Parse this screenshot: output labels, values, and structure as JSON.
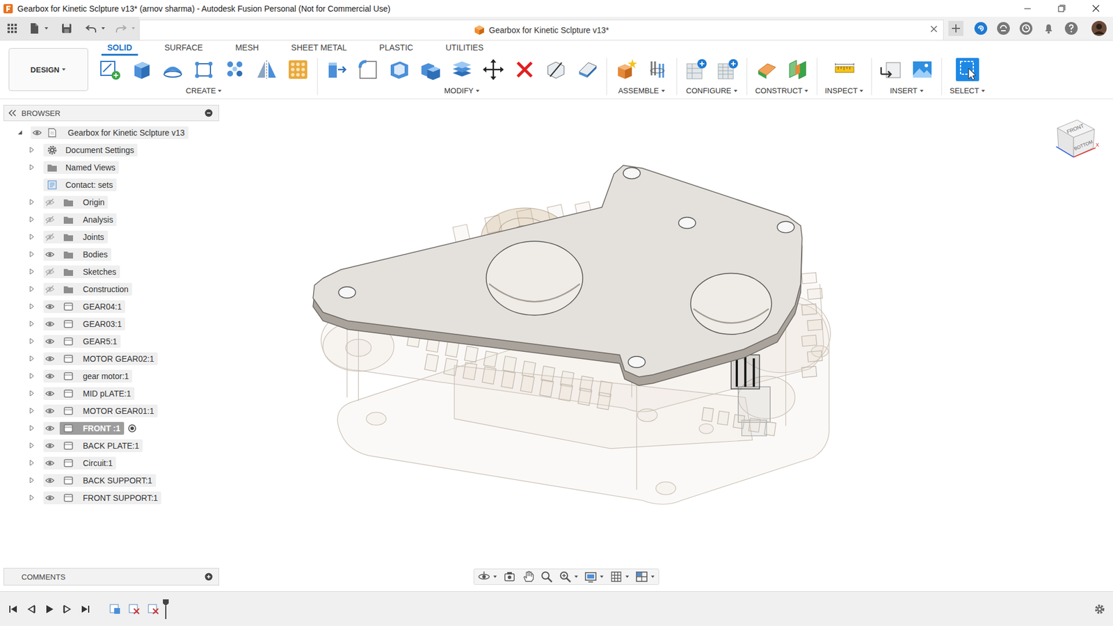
{
  "window": {
    "title": "Gearbox for Kinetic Sclpture v13* (arnov sharma) - Autodesk Fusion Personal (Not for Commercial Use)"
  },
  "document_tab": {
    "label": "Gearbox for Kinetic Sclpture v13*",
    "selected": true
  },
  "workspace": {
    "label": "DESIGN"
  },
  "tabs": [
    {
      "label": "SOLID",
      "selected": true
    },
    {
      "label": "SURFACE",
      "selected": false
    },
    {
      "label": "MESH",
      "selected": false
    },
    {
      "label": "SHEET METAL",
      "selected": false
    },
    {
      "label": "PLASTIC",
      "selected": false
    },
    {
      "label": "UTILITIES",
      "selected": false
    }
  ],
  "tool_groups": [
    {
      "label": "CREATE",
      "active": false
    },
    {
      "label": "MODIFY",
      "active": false
    },
    {
      "label": "ASSEMBLE",
      "active": false
    },
    {
      "label": "CONFIGURE",
      "active": false
    },
    {
      "label": "CONSTRUCT",
      "active": false
    },
    {
      "label": "INSPECT",
      "active": false
    },
    {
      "label": "INSERT",
      "active": false
    },
    {
      "label": "SELECT",
      "active": true
    }
  ],
  "browser": {
    "title": "BROWSER",
    "root": {
      "label": "Gearbox for Kinetic Sclpture v13",
      "expanded": true,
      "visible": true
    },
    "items": [
      {
        "label": "Document Settings",
        "kind": "settings",
        "visible": null,
        "expandable": true,
        "expanded": false,
        "selected": false,
        "active": false
      },
      {
        "label": "Named Views",
        "kind": "views",
        "visible": null,
        "expandable": true,
        "expanded": false,
        "selected": false,
        "active": false
      },
      {
        "label": "Contact: sets",
        "kind": "contact",
        "visible": null,
        "expandable": false,
        "expanded": false,
        "selected": false,
        "active": false
      },
      {
        "label": "Origin",
        "kind": "folder",
        "visible": false,
        "expandable": true,
        "expanded": false,
        "selected": false,
        "active": false
      },
      {
        "label": "Analysis",
        "kind": "folder",
        "visible": false,
        "expandable": true,
        "expanded": false,
        "selected": false,
        "active": false
      },
      {
        "label": "Joints",
        "kind": "folder",
        "visible": false,
        "expandable": true,
        "expanded": false,
        "selected": false,
        "active": false
      },
      {
        "label": "Bodies",
        "kind": "folder",
        "visible": true,
        "expandable": true,
        "expanded": false,
        "selected": false,
        "active": false
      },
      {
        "label": "Sketches",
        "kind": "folder",
        "visible": false,
        "expandable": true,
        "expanded": false,
        "selected": false,
        "active": false
      },
      {
        "label": "Construction",
        "kind": "folder",
        "visible": false,
        "expandable": true,
        "expanded": false,
        "selected": false,
        "active": false
      },
      {
        "label": "GEAR04:1",
        "kind": "component",
        "visible": true,
        "expandable": true,
        "expanded": false,
        "selected": false,
        "active": false
      },
      {
        "label": "GEAR03:1",
        "kind": "component",
        "visible": true,
        "expandable": true,
        "expanded": false,
        "selected": false,
        "active": false
      },
      {
        "label": "GEAR5:1",
        "kind": "component",
        "visible": true,
        "expandable": true,
        "expanded": false,
        "selected": false,
        "active": false
      },
      {
        "label": "MOTOR GEAR02:1",
        "kind": "component",
        "visible": true,
        "expandable": true,
        "expanded": false,
        "selected": false,
        "active": false
      },
      {
        "label": "gear motor:1",
        "kind": "component",
        "visible": true,
        "expandable": true,
        "expanded": false,
        "selected": false,
        "active": false
      },
      {
        "label": "MID pLATE:1",
        "kind": "component",
        "visible": true,
        "expandable": true,
        "expanded": false,
        "selected": false,
        "active": false
      },
      {
        "label": "MOTOR GEAR01:1",
        "kind": "component",
        "visible": true,
        "expandable": true,
        "expanded": false,
        "selected": false,
        "active": false
      },
      {
        "label": "FRONT :1",
        "kind": "component",
        "visible": true,
        "expandable": true,
        "expanded": false,
        "selected": true,
        "active": true
      },
      {
        "label": "BACK PLATE:1",
        "kind": "component",
        "visible": true,
        "expandable": true,
        "expanded": false,
        "selected": false,
        "active": false
      },
      {
        "label": "Circuit:1",
        "kind": "component",
        "visible": true,
        "expandable": true,
        "expanded": false,
        "selected": false,
        "active": false
      },
      {
        "label": "BACK SUPPORT:1",
        "kind": "component",
        "visible": true,
        "expandable": true,
        "expanded": false,
        "selected": false,
        "active": false
      },
      {
        "label": "FRONT SUPPORT:1",
        "kind": "component",
        "visible": true,
        "expandable": true,
        "expanded": false,
        "selected": false,
        "active": false
      }
    ]
  },
  "comments": {
    "title": "COMMENTS"
  },
  "viewcube": {
    "faces": [
      "FRONT",
      "BOTTOM"
    ],
    "axis": "X"
  }
}
